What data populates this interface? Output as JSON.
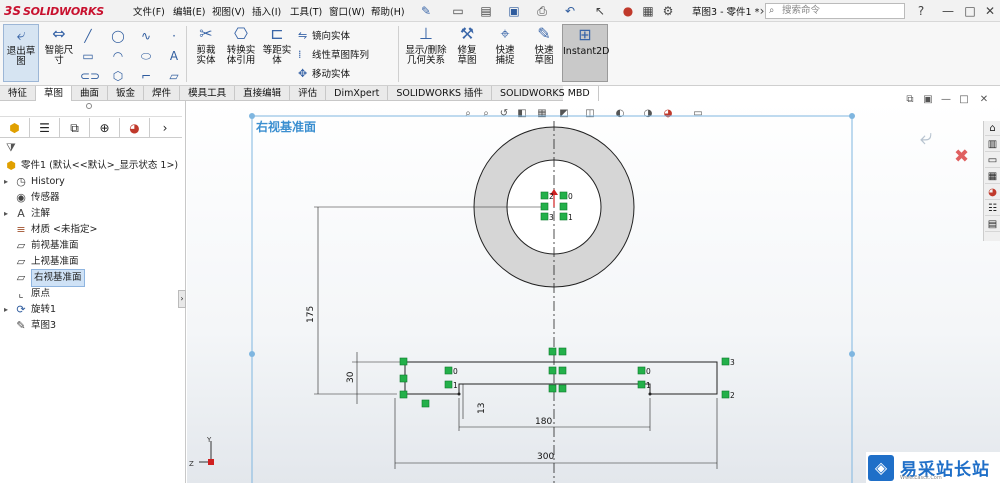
{
  "titlebar": {
    "brand_ds": "3S",
    "brand": "SOLIDWORKS",
    "menus": [
      "文件(F)",
      "编辑(E)",
      "视图(V)",
      "插入(I)",
      "工具(T)",
      "窗口(W)",
      "帮助(H)"
    ],
    "doc_title": "草图3 - 零件1 *",
    "search_placeholder": "搜索命令",
    "help": "?",
    "window_min": "—",
    "window_max": "□",
    "window_close": "✕"
  },
  "ribbon": {
    "exit_sketch": "退出草图",
    "smart_dim": "智能尺寸",
    "trim": "剪裁实体",
    "convert": "转换实体引用",
    "offset": "等距实体",
    "mirror": "镜向实体",
    "linear_pattern": "线性草图阵列",
    "move": "移动实体",
    "show_relations": "显示/删除几何关系",
    "repair": "修复草图",
    "quick_snap": "快速捕捉",
    "rapid_sketch": "快速草图",
    "instant2d": "Instant2D"
  },
  "tabs": [
    "特征",
    "草图",
    "曲面",
    "钣金",
    "焊件",
    "模具工具",
    "直接编辑",
    "评估",
    "DimXpert",
    "SOLIDWORKS 插件",
    "SOLIDWORKS MBD"
  ],
  "active_tab": "草图",
  "tree": {
    "root": "零件1 (默认<<默认>_显示状态 1>)",
    "items": [
      {
        "label": "History",
        "icon": "history-icon"
      },
      {
        "label": "传感器",
        "icon": "sensor-icon"
      },
      {
        "label": "注解",
        "icon": "annotation-icon"
      },
      {
        "label": "材质 <未指定>",
        "icon": "material-icon"
      },
      {
        "label": "前视基准面",
        "icon": "plane-icon"
      },
      {
        "label": "上视基准面",
        "icon": "plane-icon"
      },
      {
        "label": "右视基准面",
        "icon": "plane-icon"
      },
      {
        "label": "原点",
        "icon": "origin-icon"
      },
      {
        "label": "旋转1",
        "icon": "revolve-icon"
      },
      {
        "label": "草图3",
        "icon": "sketch-icon"
      }
    ]
  },
  "graphics": {
    "plane_label": "右视基准面",
    "dimensions": {
      "vertical_175": "175",
      "height_30": "30",
      "depth_13": "13",
      "width_180": "180",
      "width_300": "300"
    },
    "relations": [
      "2",
      "0",
      "3",
      "1",
      "0",
      "1",
      "3",
      "2",
      "0",
      "1"
    ],
    "triad": {
      "y": "Y",
      "z": "Z"
    }
  },
  "watermark": {
    "text": "易采站长站",
    "sub": "Www.Easck.Com"
  }
}
